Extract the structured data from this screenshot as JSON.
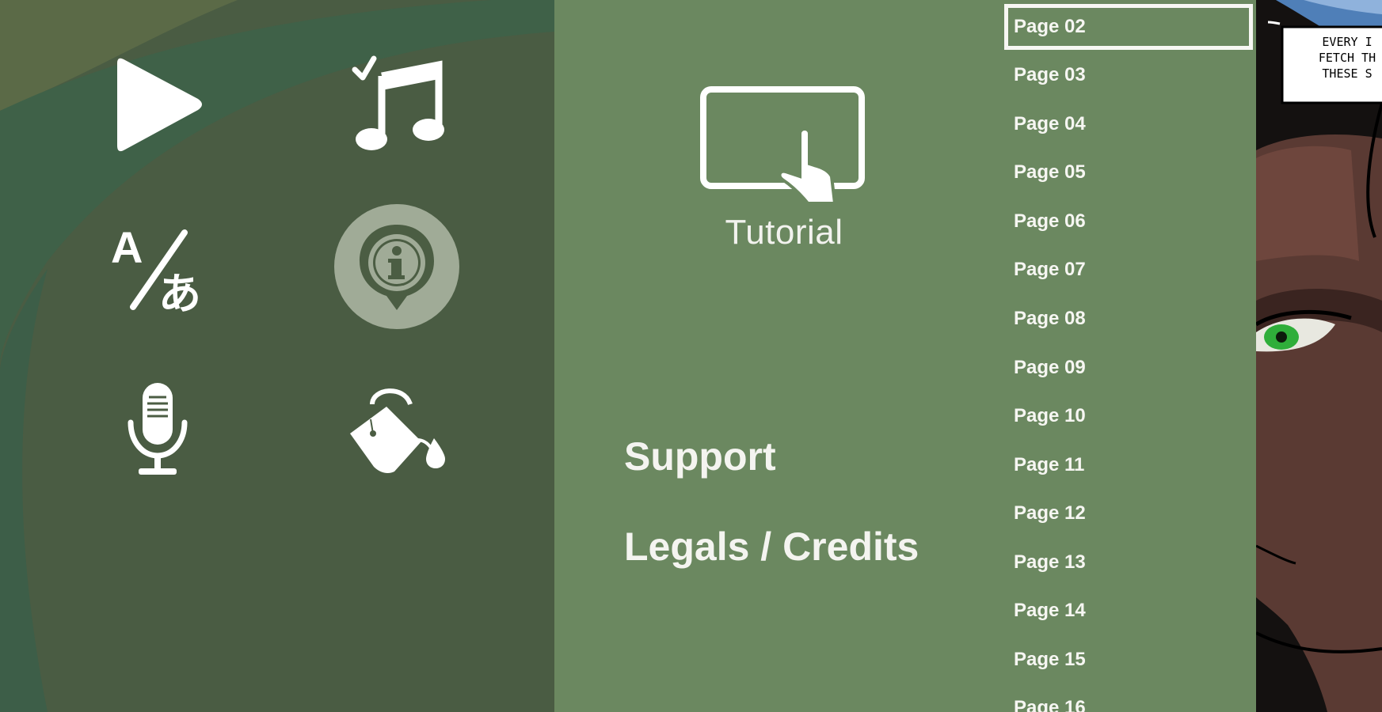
{
  "left_panel": {
    "icons": [
      "play-icon",
      "music-icon",
      "translate-icon",
      "info-icon",
      "microphone-icon",
      "paint-bucket-icon"
    ]
  },
  "middle_panel": {
    "tutorial_label": "Tutorial",
    "support_label": "Support",
    "legals_label": "Legals / Credits"
  },
  "page_list": {
    "selected": "Page 02",
    "items": [
      "Page 02",
      "Page 03",
      "Page 04",
      "Page 05",
      "Page 06",
      "Page 07",
      "Page 08",
      "Page 09",
      "Page 10",
      "Page 11",
      "Page 12",
      "Page 13",
      "Page 14",
      "Page 15",
      "Page 16"
    ]
  },
  "comic": {
    "caption_lines": [
      "EVERY I",
      "FETCH TH",
      "THESE S"
    ]
  },
  "colors": {
    "left_panel": "#4b5d43",
    "middle_panel": "#6b8860",
    "text": "#f4f4f0",
    "eye_green": "#2fae3a"
  }
}
